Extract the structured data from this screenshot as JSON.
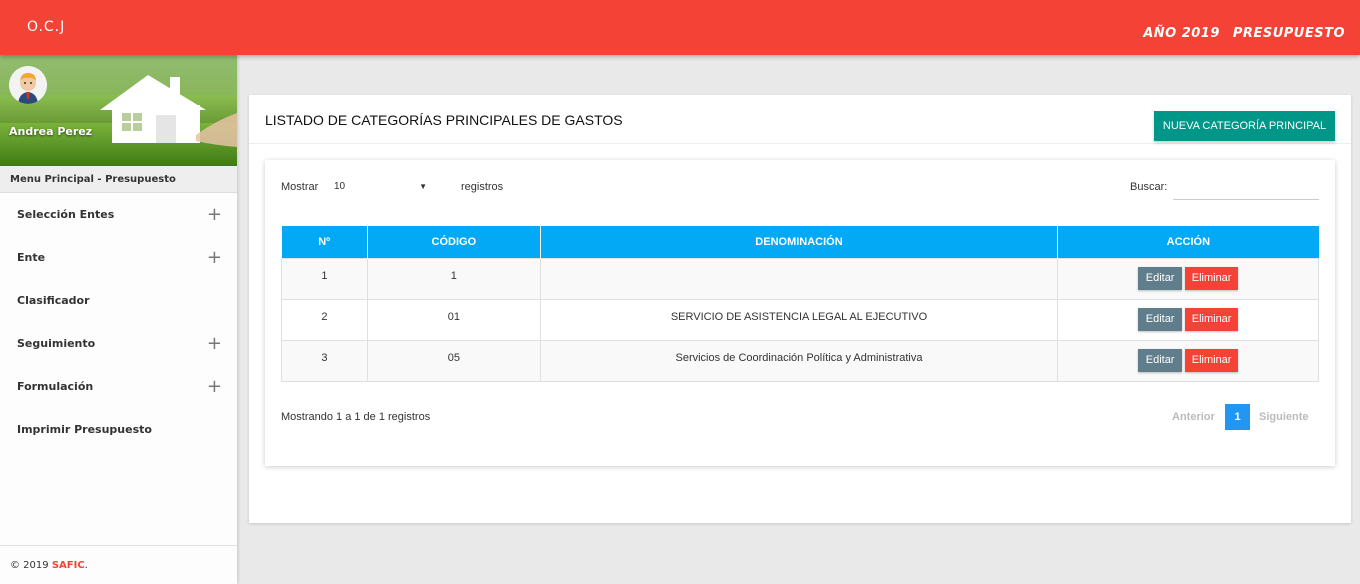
{
  "topbar": {
    "brand": "O.C.J",
    "year_label": "AÑO 2019",
    "section_label": "PRESUPUESTO"
  },
  "sidebar": {
    "user_name": "Andrea Perez",
    "menu_header": "Menu Principal - Presupuesto",
    "items": [
      {
        "label": "Selección Entes",
        "expandable": true
      },
      {
        "label": "Ente",
        "expandable": true
      },
      {
        "label": "Clasificador",
        "expandable": false
      },
      {
        "label": "Seguimiento",
        "expandable": true
      },
      {
        "label": "Formulación",
        "expandable": true
      },
      {
        "label": "Imprimir Presupuesto",
        "expandable": false
      }
    ],
    "expand_icon": "+",
    "footer_prefix": "© 2019",
    "footer_brand": "SAFIC",
    "footer_suffix": "."
  },
  "card": {
    "title": "LISTADO DE CATEGORÍAS PRINCIPALES DE GASTOS",
    "new_button": "NUEVA CATEGORÍA PRINCIPAL"
  },
  "controls": {
    "show_label": "Mostrar",
    "page_size": "10",
    "records_label": "registros",
    "search_label": "Buscar:",
    "search_value": ""
  },
  "table": {
    "headers": [
      "Nº",
      "CÓDIGO",
      "DENOMINACIÓN",
      "ACCIÓN"
    ],
    "rows": [
      {
        "n": "1",
        "code": "1",
        "name": ""
      },
      {
        "n": "2",
        "code": "01",
        "name": "SERVICIO DE ASISTENCIA LEGAL AL EJECUTIVO"
      },
      {
        "n": "3",
        "code": "05",
        "name": "Servicios de Coordinación Política y Administrativa"
      }
    ],
    "edit_label": "Editar",
    "delete_label": "Eliminar"
  },
  "footer": {
    "info": "Mostrando 1 a 1 de 1 registros",
    "prev": "Anterior",
    "current_page": "1",
    "next": "Siguiente"
  },
  "colors": {
    "primary": "#f44336",
    "teal": "#009688",
    "table_header": "#03a9f4",
    "edit": "#607d8b",
    "page_active": "#2196f3"
  }
}
